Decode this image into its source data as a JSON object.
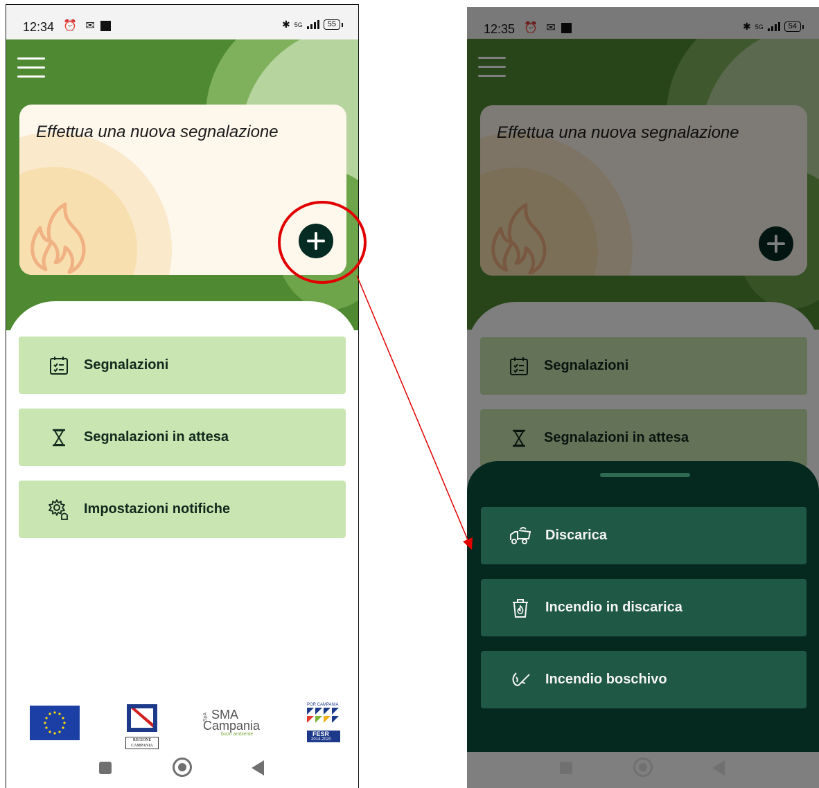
{
  "left_screen": {
    "status": {
      "time": "12:34",
      "network": "5G",
      "battery": "55"
    },
    "card_title": "Effettua una nuova segnalazione",
    "menu": [
      {
        "label": "Segnalazioni",
        "icon": "checklist-calendar-icon"
      },
      {
        "label": "Segnalazioni in attesa",
        "icon": "hourglass-icon"
      },
      {
        "label": "Impostazioni notifiche",
        "icon": "notification-settings-icon"
      }
    ],
    "logos": {
      "regione": "REGIONE CAMPANIA",
      "sma_prefix": "SpA",
      "sma_top": "SMA",
      "sma_bottom": "Campania",
      "sma_tag": "buon ambiente",
      "fesr_top": "POR CAMPANIA",
      "fesr_mid": "FESR",
      "fesr_years": "2014-2020"
    }
  },
  "right_screen": {
    "status": {
      "time": "12:35",
      "network": "5G",
      "battery": "54"
    },
    "card_title": "Effettua una nuova segnalazione",
    "menu": [
      {
        "label": "Segnalazioni",
        "icon": "checklist-calendar-icon"
      },
      {
        "label": "Segnalazioni in attesa",
        "icon": "hourglass-icon"
      }
    ],
    "sheet_options": [
      {
        "label": "Discarica",
        "icon": "dump-truck-icon"
      },
      {
        "label": "Incendio in discarica",
        "icon": "bin-fire-icon"
      },
      {
        "label": "Incendio boschivo",
        "icon": "forest-fire-icon"
      }
    ]
  },
  "colors": {
    "header_green": "#4f8a33",
    "menu_button": "#c9e5b1",
    "sheet_bg": "#05291f",
    "sheet_button": "#1f5844",
    "fab": "#062b22",
    "annotation_red": "#e00000"
  }
}
